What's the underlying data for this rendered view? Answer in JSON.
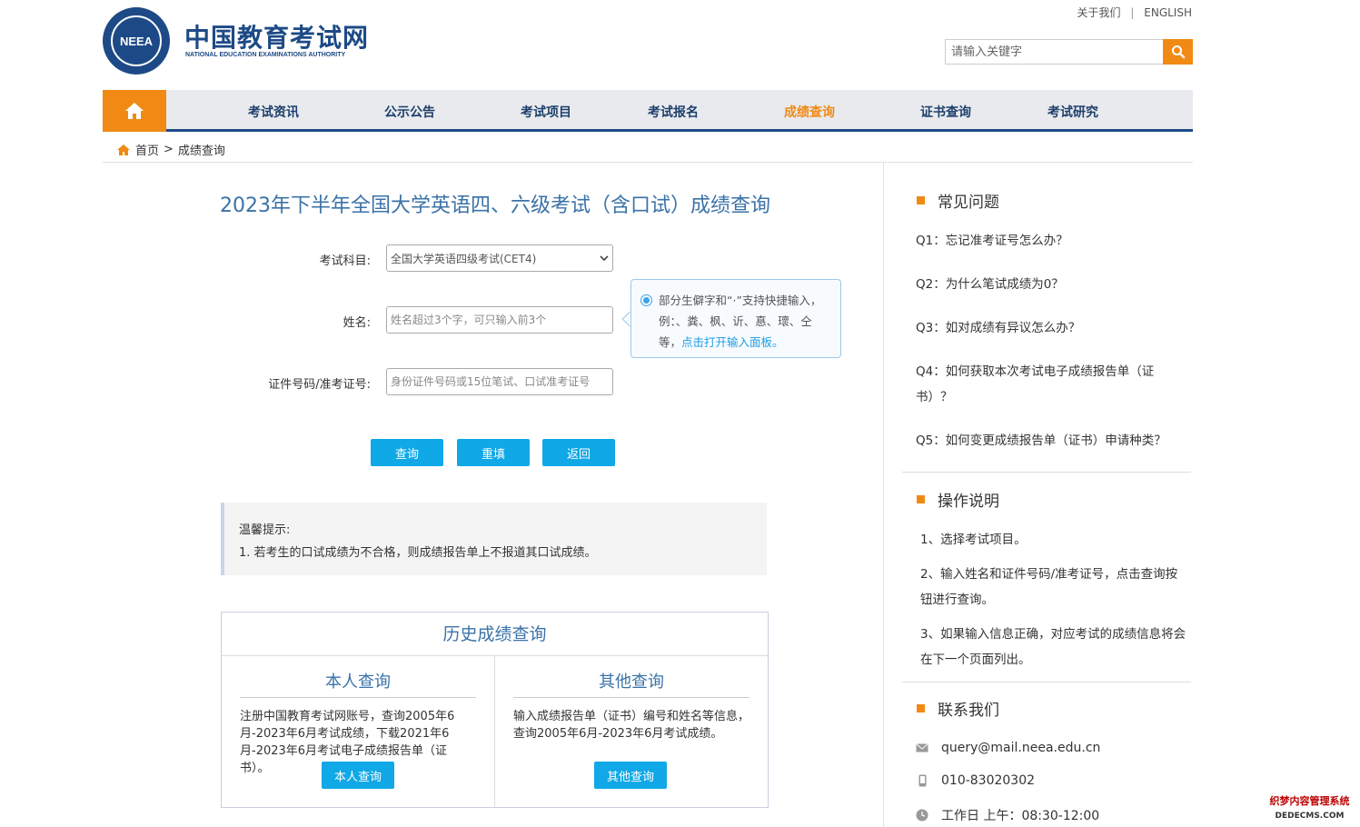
{
  "header": {
    "logo_text": "NEEA",
    "brand_cn": "中国教育考试网",
    "brand_en": "NATIONAL EDUCATION EXAMINATIONS AUTHORITY",
    "about": "关于我们",
    "sep": "|",
    "english": "ENGLISH",
    "search_placeholder": "请输入关键字"
  },
  "nav": {
    "items": [
      "考试资讯",
      "公示公告",
      "考试项目",
      "考试报名",
      "成绩查询",
      "证书查询",
      "考试研究"
    ],
    "active_index": 4
  },
  "breadcrumb": {
    "home": "首页",
    "sep": ">",
    "current": "成绩查询"
  },
  "form": {
    "title": "2023年下半年全国大学英语四、六级考试（含口试）成绩查询",
    "subject_label": "考试科目:",
    "subject_value": "全国大学英语四级考试(CET4)",
    "name_label": "姓名:",
    "name_placeholder": "姓名超过3个字，可只输入前3个",
    "id_label": "证件号码/准考证号:",
    "id_placeholder": "身份证件号码或15位笔试、口试准考证号",
    "tip_text": "部分生僻字和“·”支持快捷输入，例：、粪、枫、䜣、惪、瓌、仝等，",
    "tip_link": "点击打开输入面板。",
    "btn_query": "查询",
    "btn_reset": "重填",
    "btn_back": "返回"
  },
  "notice": {
    "title": "温馨提示:",
    "line1": "1. 若考生的口试成绩为不合格，则成绩报告单上不报道其口试成绩。"
  },
  "history": {
    "title": "历史成绩查询",
    "self_title": "本人查询",
    "self_text": "注册中国教育考试网账号，查询2005年6月-2023年6月考试成绩，下载2021年6月-2023年6月考试电子成绩报告单（证书）。",
    "self_btn": "本人查询",
    "other_title": "其他查询",
    "other_text": "输入成绩报告单（证书）编号和姓名等信息，查询2005年6月-2023年6月考试成绩。",
    "other_btn": "其他查询"
  },
  "sidebar": {
    "faq_title": "常见问题",
    "faq": [
      "Q1：忘记准考证号怎么办？",
      "Q2：为什么笔试成绩为0？",
      "Q3：如对成绩有异议怎么办？",
      "Q4：如何获取本次考试电子成绩报告单（证书）？",
      "Q5：如何变更成绩报告单（证书）申请种类？"
    ],
    "ops_title": "操作说明",
    "ops": [
      "1、选择考试项目。",
      "2、输入姓名和证件号码/准考证号，点击查询按钮进行查询。",
      "3、如果输入信息正确，对应考试的成绩信息将会在下一个页面列出。"
    ],
    "contact_title": "联系我们",
    "email": "query@mail.neea.edu.cn",
    "phone": "010-83020302",
    "hours": "工作日 上午：08:30-12:00"
  },
  "watermark": {
    "line1": "织梦内容管理系统",
    "line2": "DEDECMS.COM"
  },
  "colors": {
    "brand": "#1d4a86",
    "accent": "#f08a15",
    "button": "#10a8e6",
    "title": "#3b72a8"
  }
}
